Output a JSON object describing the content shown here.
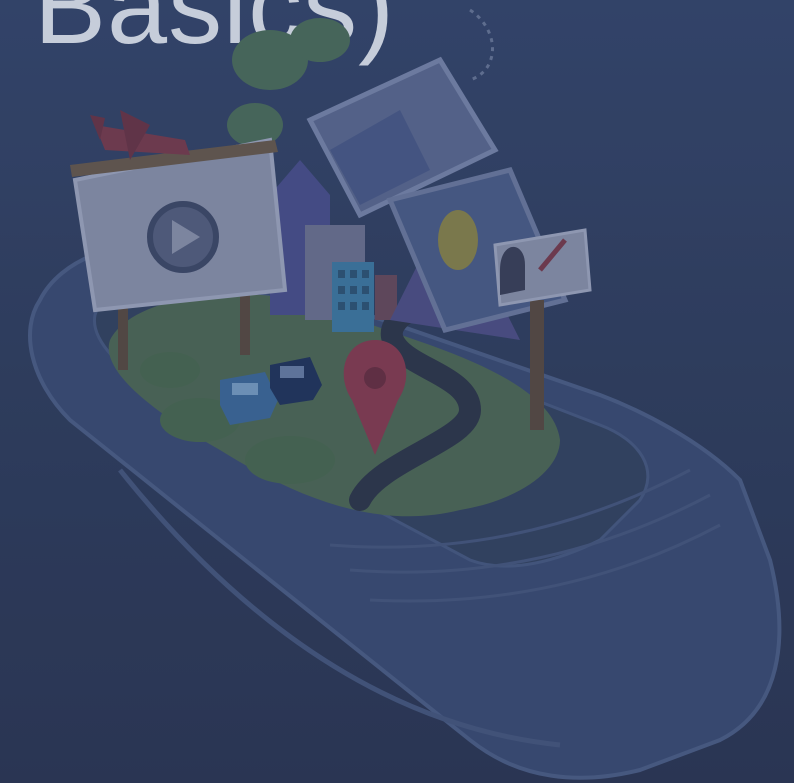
{
  "slide": {
    "title_text": "Basics)"
  },
  "illustration": {
    "icons": [
      "airplane-icon",
      "play-icon",
      "map-pin-icon",
      "mailbox-icon",
      "car-icon",
      "building-icon",
      "cloud-icon"
    ]
  },
  "colors": {
    "background": "#2f3d5c",
    "title": "#e8edf5",
    "overlay": "#2f3f63"
  }
}
